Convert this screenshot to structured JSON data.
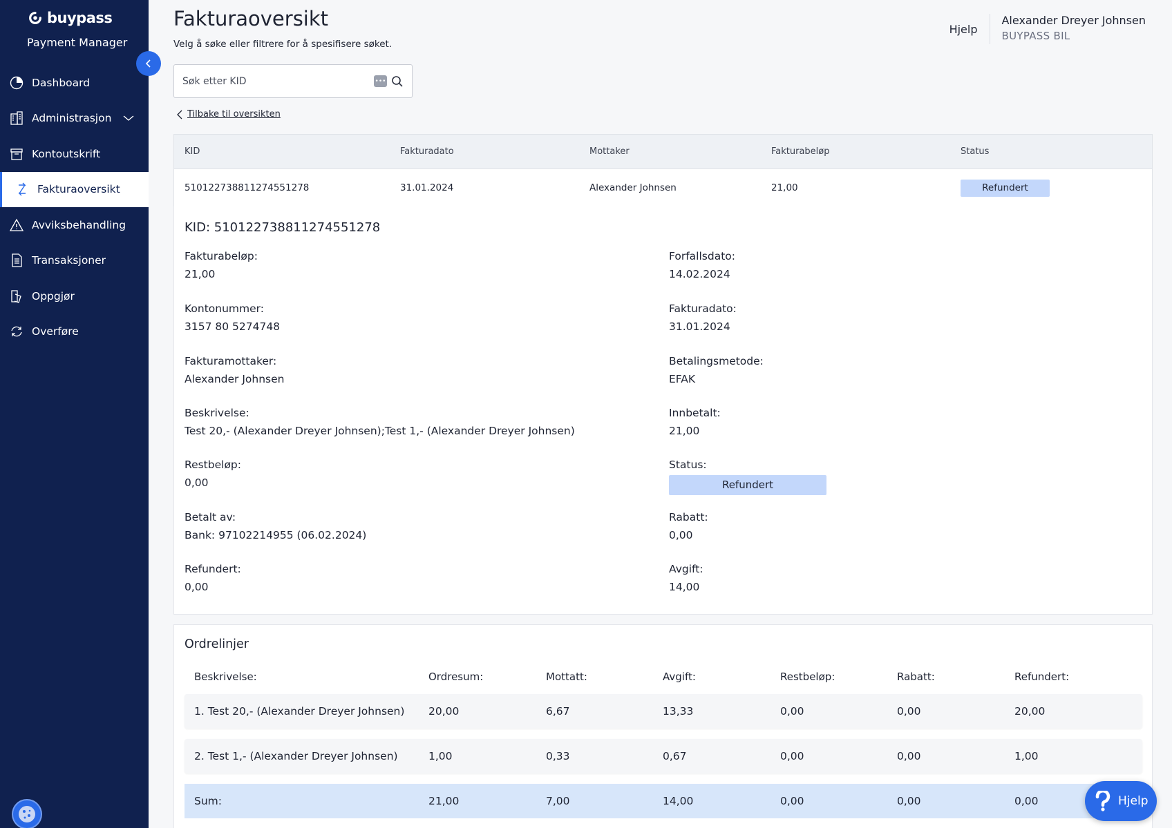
{
  "sidebar": {
    "brand": "buypass",
    "product": "Payment Manager",
    "items": [
      {
        "label": "Dashboard",
        "icon": "dashboard-icon"
      },
      {
        "label": "Administrasjon",
        "icon": "building-icon"
      },
      {
        "label": "Kontoutskrift",
        "icon": "archive-icon"
      },
      {
        "label": "Fakturaoversikt",
        "icon": "transfer-arrows-icon"
      },
      {
        "label": "Avviksbehandling",
        "icon": "warning-icon"
      },
      {
        "label": "Transaksjoner",
        "icon": "document-icon"
      },
      {
        "label": "Oppgjør",
        "icon": "receipt-icon"
      },
      {
        "label": "Overføre",
        "icon": "refresh-icon"
      }
    ],
    "active_index": 3
  },
  "header": {
    "title": "Fakturaoversikt",
    "subtitle": "Velg å søke eller filtrere for å spesifisere søket.",
    "help": "Hjelp",
    "user_name": "Alexander Dreyer Johnsen",
    "user_org": "BUYPASS BIL"
  },
  "search": {
    "placeholder": "Søk etter KID"
  },
  "back_link": "Tilbake til oversikten",
  "summary": {
    "columns": [
      "KID",
      "Fakturadato",
      "Mottaker",
      "Fakturabeløp",
      "Status"
    ],
    "row": {
      "kid": "510122738811274551278",
      "date": "31.01.2024",
      "recipient": "Alexander Johnsen",
      "amount": "21,00",
      "status": "Refundert"
    }
  },
  "detail": {
    "kid_title": "KID: 510122738811274551278",
    "left": [
      {
        "label": "Fakturabeløp:",
        "value": "21,00"
      },
      {
        "label": "Kontonummer:",
        "value": "3157 80 5274748"
      },
      {
        "label": "Fakturamottaker:",
        "value": "Alexander Johnsen"
      },
      {
        "label": "Beskrivelse:",
        "value": "Test 20,- (Alexander Dreyer Johnsen);Test 1,- (Alexander Dreyer Johnsen)"
      },
      {
        "label": "Restbeløp:",
        "value": "0,00"
      },
      {
        "label": "Betalt av:",
        "value": "Bank: 97102214955 (06.02.2024)"
      },
      {
        "label": "Refundert:",
        "value": "0,00"
      }
    ],
    "right": [
      {
        "label": "Forfallsdato:",
        "value": "14.02.2024"
      },
      {
        "label": "Fakturadato:",
        "value": "31.01.2024"
      },
      {
        "label": "Betalingsmetode:",
        "value": "EFAK"
      },
      {
        "label": "Innbetalt:",
        "value": "21,00"
      },
      {
        "label": "Status:",
        "value": "Refundert"
      },
      {
        "label": "Rabatt:",
        "value": "0,00"
      },
      {
        "label": "Avgift:",
        "value": "14,00"
      }
    ]
  },
  "orders": {
    "title": "Ordrelinjer",
    "columns": [
      "Beskrivelse:",
      "Ordresum:",
      "Mottatt:",
      "Avgift:",
      "Restbeløp:",
      "Rabatt:",
      "Refundert:"
    ],
    "rows": [
      [
        "1. Test 20,- (Alexander Dreyer Johnsen)",
        "20,00",
        "6,67",
        "13,33",
        "0,00",
        "0,00",
        "20,00"
      ],
      [
        "2. Test 1,- (Alexander Dreyer Johnsen)",
        "1,00",
        "0,33",
        "0,67",
        "0,00",
        "0,00",
        "1,00"
      ]
    ],
    "sum": [
      "Sum:",
      "21,00",
      "7,00",
      "14,00",
      "0,00",
      "0,00",
      "0,00"
    ]
  },
  "help_fab": "Hjelp",
  "colors": {
    "sidebar_bg": "#10214f",
    "accent": "#2a6ae8",
    "badge_bg": "#c3d7fb",
    "sum_row_bg": "#d7e6fa"
  }
}
